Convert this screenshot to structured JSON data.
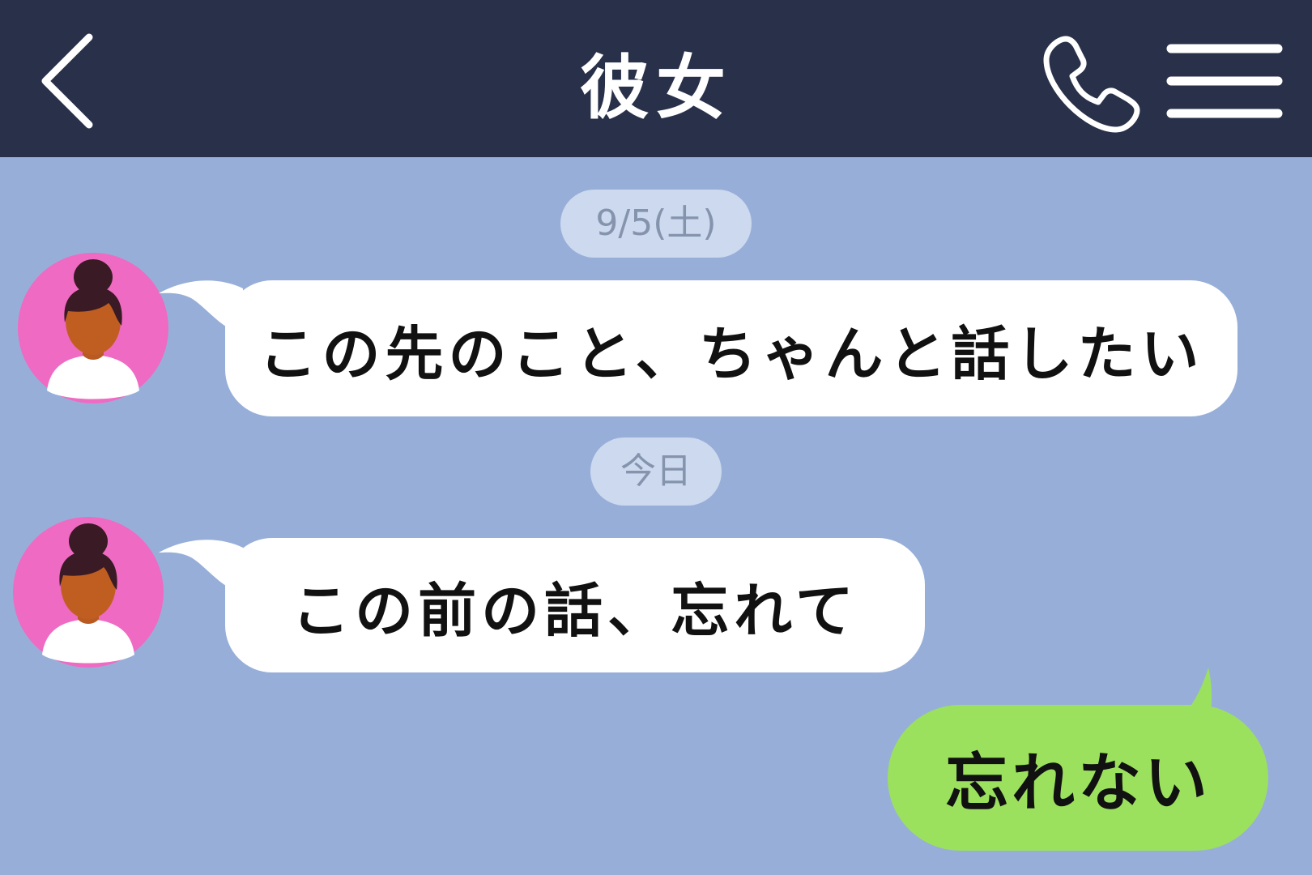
{
  "header": {
    "title": "彼女",
    "back_icon": "chevron-left-icon",
    "call_icon": "phone-icon",
    "menu_icon": "hamburger-menu-icon",
    "background": "#283149"
  },
  "chat": {
    "background": "#97afd8",
    "date_separators": [
      {
        "label": "9/5(土)"
      },
      {
        "label": "今日"
      }
    ],
    "messages": [
      {
        "sender": "contact",
        "text": "この先のこと、ちゃんと話したい"
      },
      {
        "sender": "contact",
        "text": "この前の話、忘れて"
      },
      {
        "sender": "self",
        "text": "忘れない"
      }
    ]
  },
  "colors": {
    "incoming_bubble": "#ffffff",
    "outgoing_bubble": "#9be15e",
    "avatar_ring": "#ef6ac2",
    "date_pill": "#ccd9ee"
  }
}
